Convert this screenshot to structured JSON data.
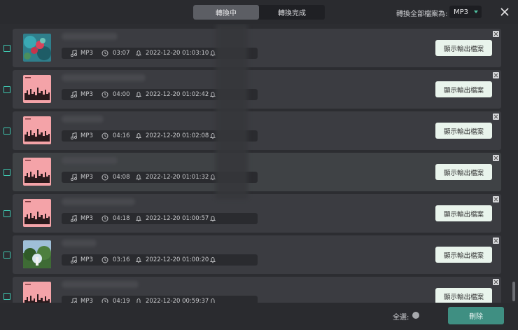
{
  "header": {
    "tabs": [
      {
        "label": "轉換中",
        "active": true
      },
      {
        "label": "轉換完成",
        "active": false
      }
    ],
    "convert_all_label": "轉換全部檔案為:",
    "format": {
      "selected": "MP3"
    },
    "close_icon": "close-icon"
  },
  "rows": [
    {
      "format": "MP3",
      "duration": "03:07",
      "timestamp": "2022-12-20 01:03:10",
      "button": "顯示輸出檔案",
      "cover": "tropical",
      "title_width": 80
    },
    {
      "format": "MP3",
      "duration": "04:00",
      "timestamp": "2022-12-20 01:02:42",
      "button": "顯示輸出檔案",
      "cover": "pink",
      "title_width": 120
    },
    {
      "format": "MP3",
      "duration": "04:16",
      "timestamp": "2022-12-20 01:02:08",
      "button": "顯示輸出檔案",
      "cover": "pink",
      "title_width": 60
    },
    {
      "format": "MP3",
      "duration": "04:08",
      "timestamp": "2022-12-20 01:01:32",
      "button": "顯示輸出檔案",
      "cover": "pink",
      "title_width": 80,
      "hover": true
    },
    {
      "format": "MP3",
      "duration": "04:18",
      "timestamp": "2022-12-20 01:00:57",
      "button": "顯示輸出檔案",
      "cover": "pink",
      "title_width": 105
    },
    {
      "format": "MP3",
      "duration": "03:16",
      "timestamp": "2022-12-20 01:00:20",
      "button": "顯示輸出檔案",
      "cover": "forest",
      "title_width": 50
    },
    {
      "format": "MP3",
      "duration": "04:19",
      "timestamp": "2022-12-20 00:59:37",
      "button": "顯示輸出檔案",
      "cover": "pink",
      "title_width": 110
    }
  ],
  "footer": {
    "select_all_label": "全選:",
    "delete_label": "刪除"
  },
  "colors": {
    "accent": "#3ec7b0",
    "delete_button": "#3f8f82",
    "output_button": "#e9f4ec",
    "background": "#2c2d31"
  }
}
